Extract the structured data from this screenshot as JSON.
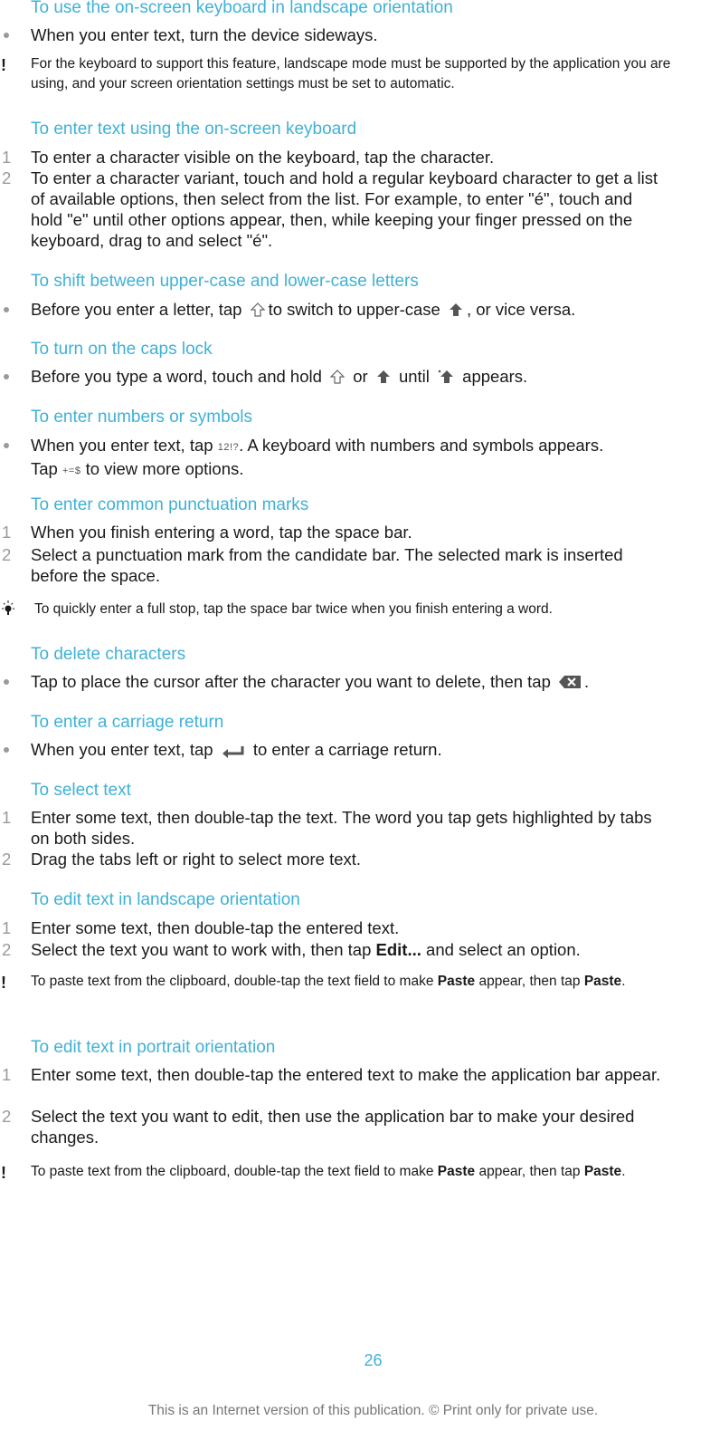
{
  "sections": [
    {
      "heading": "To use the on-screen keyboard in landscape orientation",
      "bullets": [
        "When you enter text, turn the device sideways."
      ],
      "note": "For the keyboard to support this feature, landscape mode must be supported by the application you are using, and your screen orientation settings must be set to automatic."
    },
    {
      "heading": "To enter text using the on-screen keyboard",
      "steps": [
        {
          "num": "1",
          "text": "To enter a character visible on the keyboard, tap the character."
        },
        {
          "num": "2",
          "text": "To enter a character variant, touch and hold a regular keyboard character to get a list of available options, then select from the list. For example, to enter \"é\", touch and hold \"e\" until other options appear, then, while keeping your finger pressed on the keyboard, drag to and select \"é\"."
        }
      ]
    },
    {
      "heading": "To shift between upper-case and lower-case letters",
      "bullet_parts": [
        "Before you enter a letter, tap",
        "to switch to upper-case",
        ", or vice versa."
      ]
    },
    {
      "heading": "To turn on the caps lock",
      "bullet_parts": [
        "Before you type a word, touch and hold",
        "or",
        "until",
        "appears."
      ]
    },
    {
      "heading": "To enter numbers or symbols",
      "bullet_parts": [
        "When you enter text, tap",
        ". A keyboard with numbers and symbols appears.",
        "Tap",
        "to view more options."
      ],
      "key_labels": {
        "numbers_key": "12!?",
        "more_symbols_key": "+=$"
      }
    },
    {
      "heading": "To enter common punctuation marks",
      "steps": [
        {
          "num": "1",
          "text": "When you finish entering a word, tap the space bar."
        },
        {
          "num": "2",
          "text": "Select a punctuation mark from the candidate bar. The selected mark is inserted before the space."
        }
      ],
      "tip": "To quickly enter a full stop, tap the space bar twice when you finish entering a word."
    },
    {
      "heading": "To delete characters",
      "bullet_parts": [
        "Tap to place the cursor after the character you want to delete, then tap",
        "."
      ]
    },
    {
      "heading": "To enter a carriage return",
      "bullet_parts": [
        "When you enter text, tap",
        "to enter a carriage return."
      ]
    },
    {
      "heading": "To select text",
      "steps": [
        {
          "num": "1",
          "text": "Enter some text, then double-tap the text. The word you tap gets highlighted by tabs on both sides."
        },
        {
          "num": "2",
          "text": "Drag the tabs left or right to select more text."
        }
      ]
    },
    {
      "heading": "To edit text in landscape orientation",
      "steps": [
        {
          "num": "1",
          "text": "Enter some text, then double-tap the entered text."
        },
        {
          "num": "2",
          "parts": [
            "Select the text you want to work with, then tap",
            "Edit...",
            "and select an option."
          ]
        }
      ],
      "note_parts": [
        "To paste text from the clipboard, double-tap the text field to make",
        "Paste",
        "appear, then tap",
        "Paste",
        "."
      ]
    },
    {
      "heading": "To edit text in portrait orientation",
      "steps": [
        {
          "num": "1",
          "text": "Enter some text, then double-tap the entered text to make the application bar appear."
        },
        {
          "num": "2",
          "text": "Select the text you want to edit, then use the application bar to make your desired changes."
        }
      ],
      "note_parts": [
        "To paste text from the clipboard, double-tap the text field to make",
        "Paste",
        "appear, then tap",
        "Paste",
        "."
      ]
    }
  ],
  "page_number": "26",
  "footer": "This is an Internet version of this publication. © Print only for private use.",
  "colors": {
    "heading": "#3fb1d6",
    "body": "#1a1a1a",
    "marker": "#9a9a9a",
    "footer": "#777777"
  }
}
